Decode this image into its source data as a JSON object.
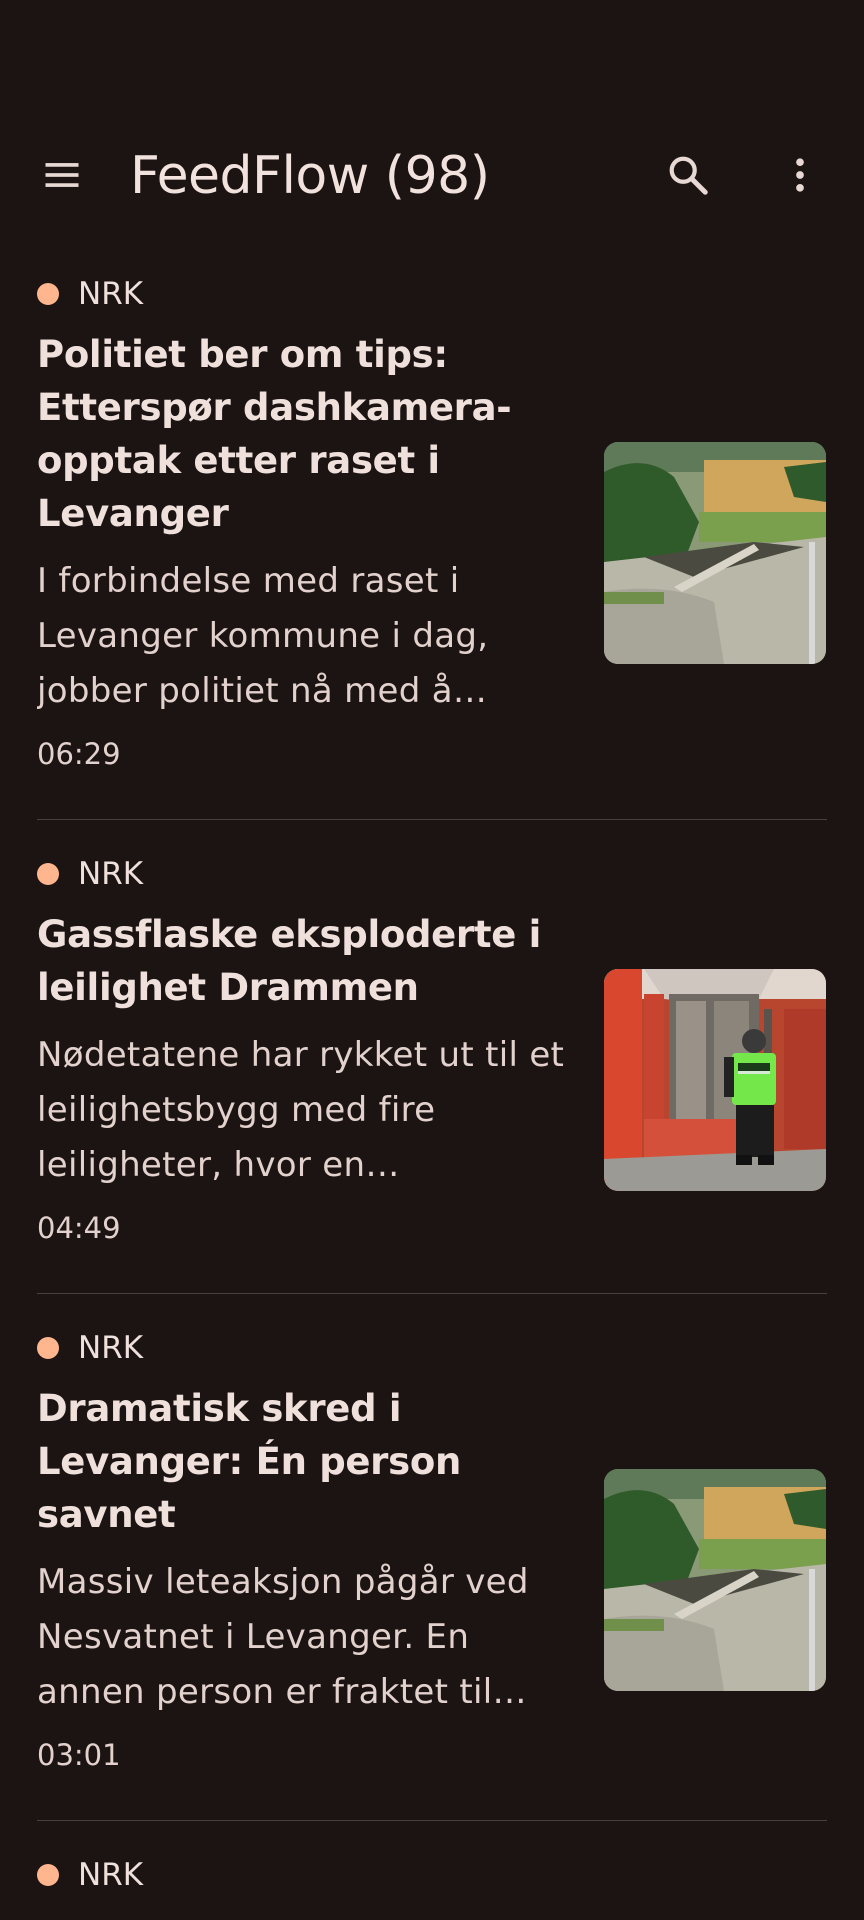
{
  "app": {
    "title": "FeedFlow (98)"
  },
  "icons": {
    "menu": "menu-icon",
    "search": "search-icon",
    "more": "more-vert-icon"
  },
  "colors": {
    "background": "#1b1412",
    "source_dot": "#ffb68e",
    "text": "#efe0dc",
    "divider": "#4a3f3c"
  },
  "articles": [
    {
      "source": "NRK",
      "title": "Politiet ber om tips: Etterspør dashkamera-opptak etter raset i Levanger",
      "summary": "I forbindelse med raset i Levanger kommune i dag, jobber politiet nå med å avklare",
      "time": "06:29",
      "image": "landslide"
    },
    {
      "source": "NRK",
      "title": "Gassflaske eksploderte i leilighet Drammen",
      "summary": "Nødetatene har rykket ut til et leilighetsbygg med fire leiligheter, hvor en propanflaske",
      "time": "04:49",
      "image": "police"
    },
    {
      "source": "NRK",
      "title": "Dramatisk skred i Levanger: Én person savnet",
      "summary": "Massiv leteaksjon pågår ved Nesvatnet i Levanger. En annen person er fraktet til sykehus",
      "time": "03:01",
      "image": "landslide"
    },
    {
      "source": "NRK"
    }
  ]
}
